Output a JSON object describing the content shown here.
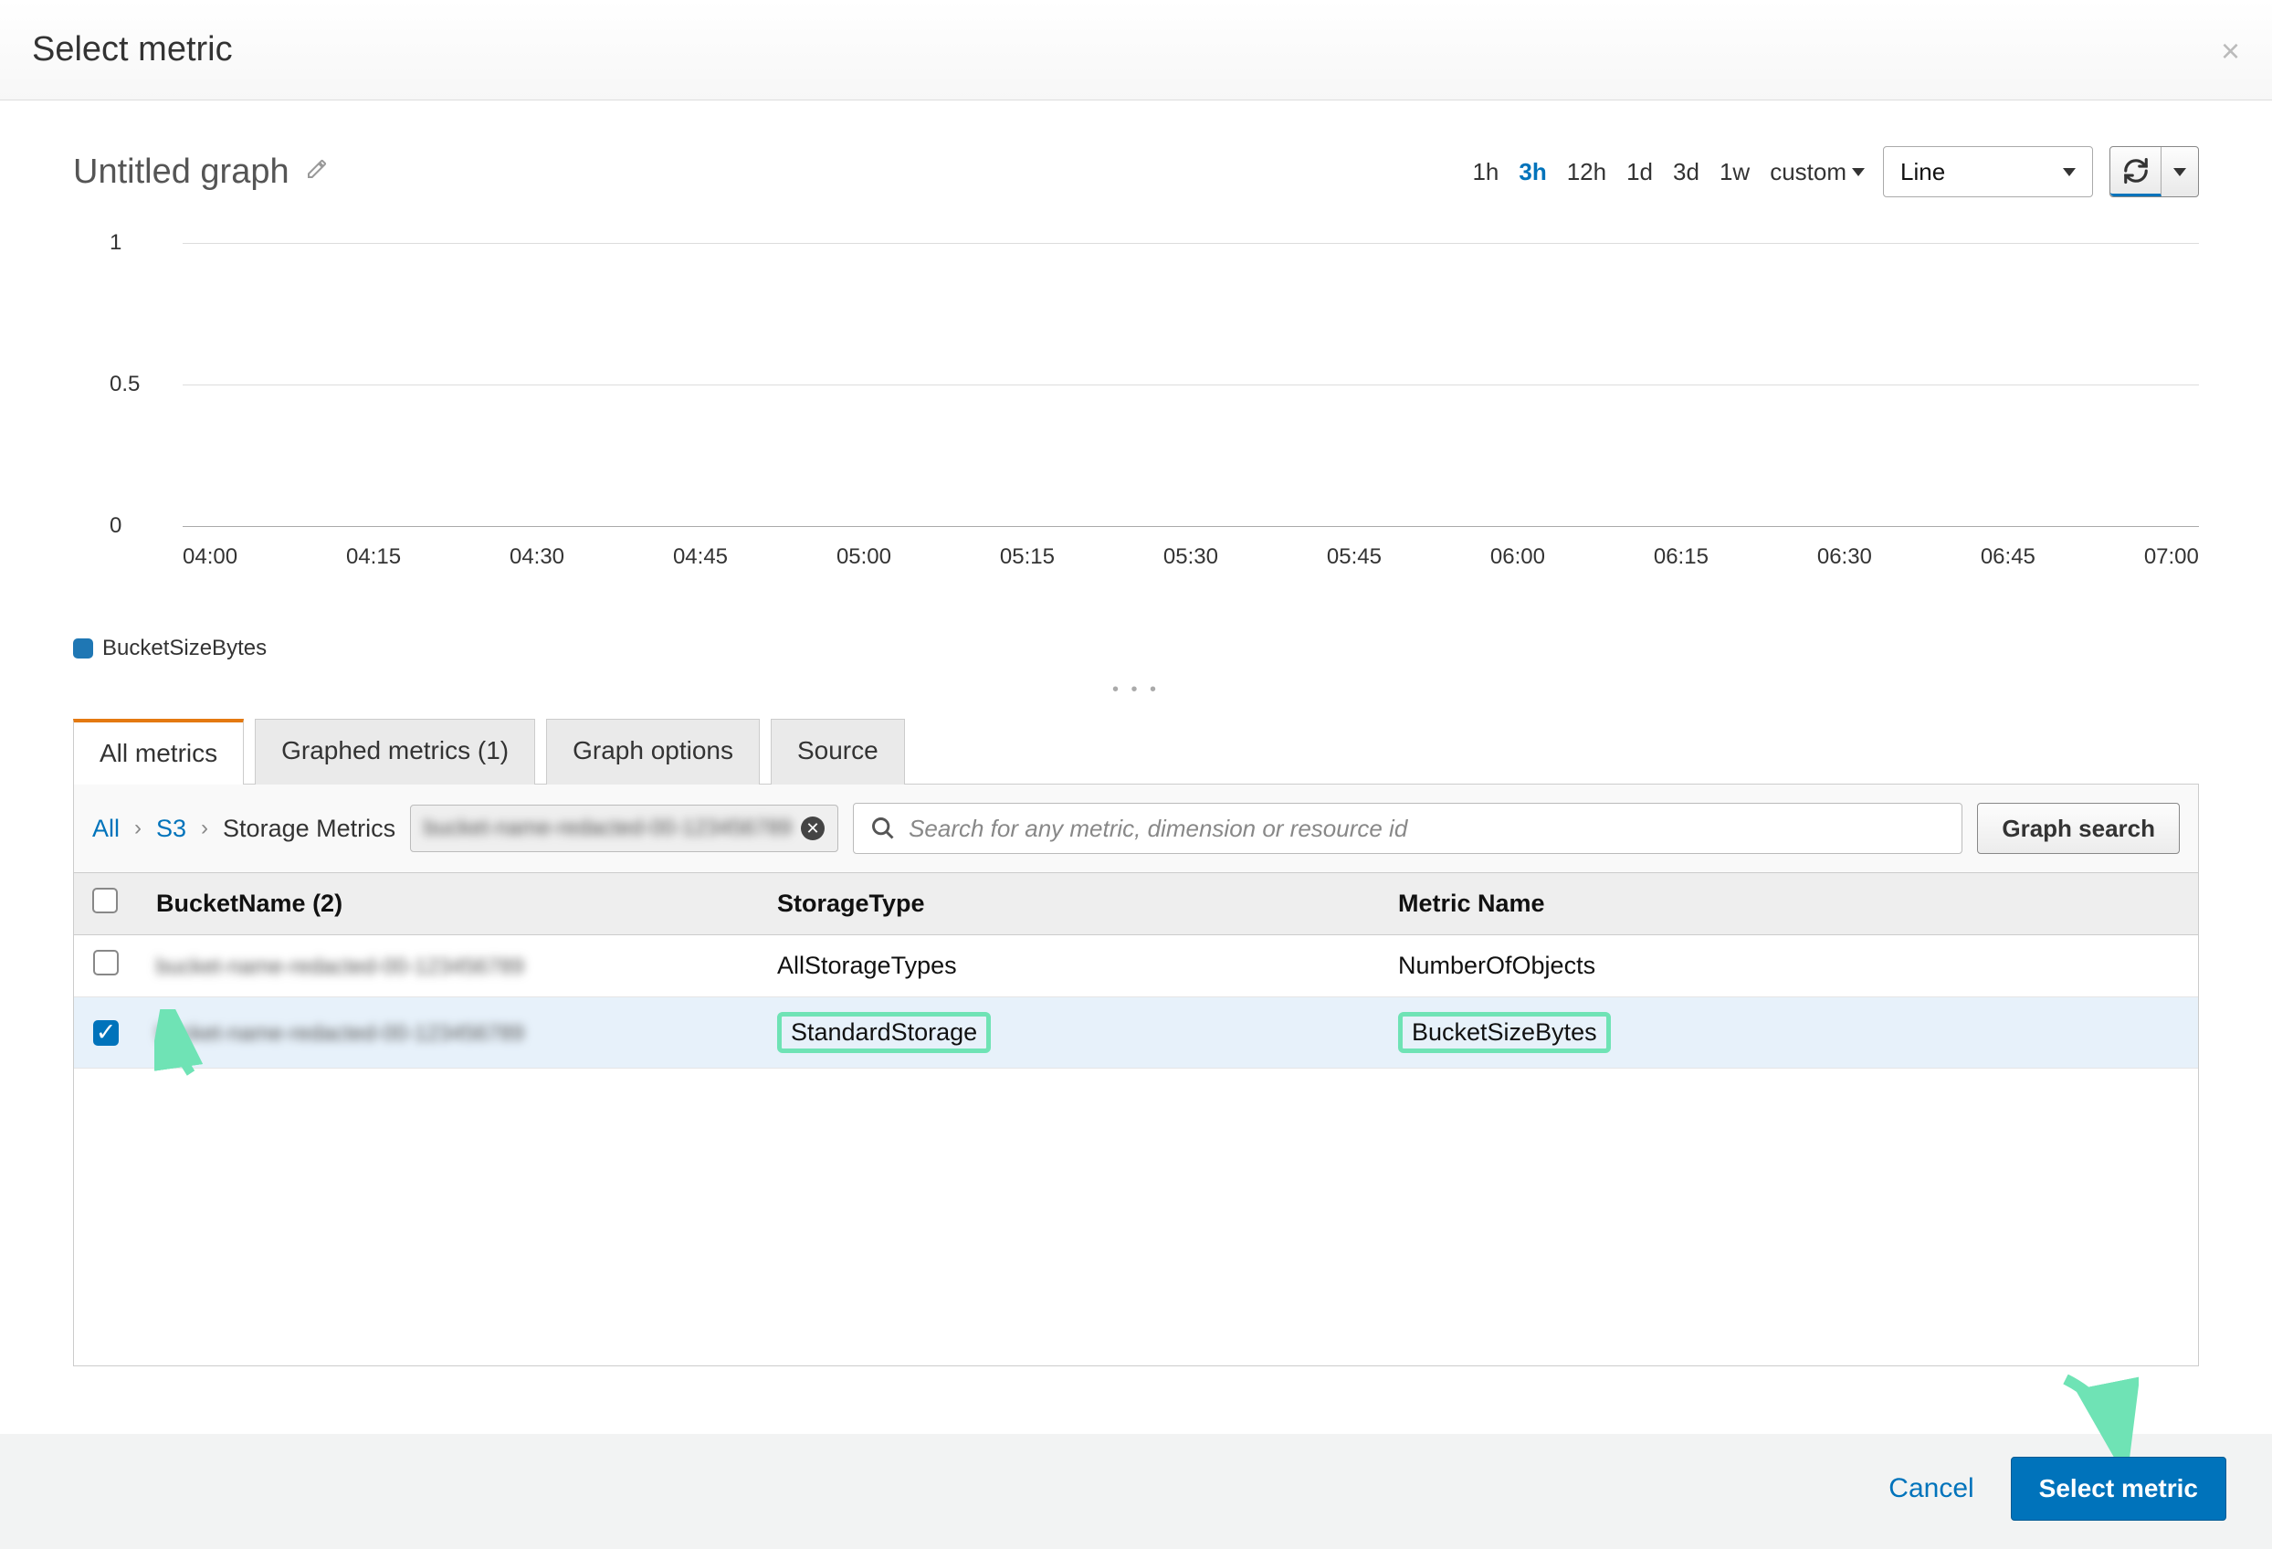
{
  "modal": {
    "title": "Select metric"
  },
  "graph": {
    "title": "Untitled graph",
    "time_options": [
      "1h",
      "3h",
      "12h",
      "1d",
      "3d",
      "1w"
    ],
    "time_custom": "custom",
    "time_selected": "3h",
    "chart_type": "Line",
    "legend_series": "BucketSizeBytes"
  },
  "chart_data": {
    "type": "line",
    "title": "",
    "xlabel": "",
    "ylabel": "",
    "ylim": [
      0,
      1
    ],
    "y_ticks": [
      0,
      0.5,
      1
    ],
    "x_ticks": [
      "04:00",
      "04:15",
      "04:30",
      "04:45",
      "05:00",
      "05:15",
      "05:30",
      "05:45",
      "06:00",
      "06:15",
      "06:30",
      "06:45",
      "07:00"
    ],
    "series": [
      {
        "name": "BucketSizeBytes",
        "color": "#1f77b4",
        "values": []
      }
    ]
  },
  "tabs": {
    "items": [
      {
        "label": "All metrics",
        "active": true
      },
      {
        "label": "Graphed metrics (1)",
        "active": false
      },
      {
        "label": "Graph options",
        "active": false
      },
      {
        "label": "Source",
        "active": false
      }
    ]
  },
  "breadcrumb": {
    "all": "All",
    "s3": "S3",
    "storage": "Storage Metrics",
    "filter_chip": "bucket-name-redacted-00-123456789"
  },
  "search": {
    "placeholder": "Search for any metric, dimension or resource id",
    "graph_search_btn": "Graph search"
  },
  "table": {
    "headers": {
      "bucket": "BucketName  (2)",
      "storage": "StorageType",
      "metric": "Metric Name"
    },
    "rows": [
      {
        "checked": false,
        "bucket": "bucket-name-redacted-00-123456789",
        "storage": "AllStorageTypes",
        "metric": "NumberOfObjects",
        "highlight": false
      },
      {
        "checked": true,
        "bucket": "bucket-name-redacted-00-123456789",
        "storage": "StandardStorage",
        "metric": "BucketSizeBytes",
        "highlight": true
      }
    ]
  },
  "footer": {
    "cancel": "Cancel",
    "select": "Select metric"
  }
}
